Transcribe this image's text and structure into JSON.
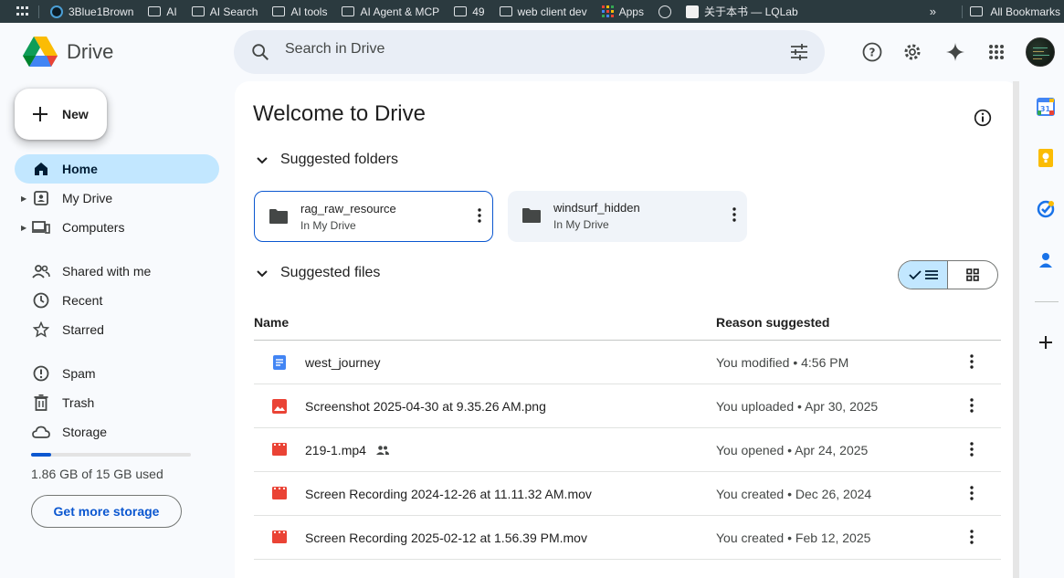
{
  "bookmarks": {
    "items": [
      "3Blue1Brown",
      "AI",
      "AI Search",
      "AI tools",
      "AI Agent & MCP",
      "49",
      "web client dev",
      "Apps",
      "",
      "关于本书 — LQLab"
    ],
    "more": "»",
    "all_bookmarks": "All Bookmarks"
  },
  "app": {
    "name": "Drive"
  },
  "search": {
    "placeholder": "Search in Drive"
  },
  "sidebar": {
    "new_label": "New",
    "items": [
      {
        "label": "Home",
        "icon": "home-icon",
        "active": true
      },
      {
        "label": "My Drive",
        "icon": "my-drive-icon"
      },
      {
        "label": "Computers",
        "icon": "computers-icon"
      },
      {
        "label": "Shared with me",
        "icon": "shared-icon"
      },
      {
        "label": "Recent",
        "icon": "clock-icon"
      },
      {
        "label": "Starred",
        "icon": "star-icon"
      },
      {
        "label": "Spam",
        "icon": "spam-icon"
      },
      {
        "label": "Trash",
        "icon": "trash-icon"
      },
      {
        "label": "Storage",
        "icon": "cloud-icon"
      }
    ],
    "storage_used_fraction": 0.124,
    "storage_text": "1.86 GB of 15 GB used",
    "get_storage": "Get more storage"
  },
  "main": {
    "title": "Welcome to Drive",
    "suggested_folders_label": "Suggested folders",
    "folders": [
      {
        "name": "rag_raw_resource",
        "location": "In My Drive"
      },
      {
        "name": "windsurf_hidden",
        "location": "In My Drive"
      }
    ],
    "suggested_files_label": "Suggested files",
    "columns": {
      "name": "Name",
      "reason": "Reason suggested"
    },
    "files": [
      {
        "name": "west_journey",
        "type": "doc",
        "reason": "You modified • 4:56 PM",
        "shared": false
      },
      {
        "name": "Screenshot 2025-04-30 at 9.35.26 AM.png",
        "type": "image",
        "reason": "You uploaded • Apr 30, 2025",
        "shared": false
      },
      {
        "name": "219-1.mp4",
        "type": "video",
        "reason": "You opened • Apr 24, 2025",
        "shared": true
      },
      {
        "name": "Screen Recording 2024-12-26 at 11.11.32 AM.mov",
        "type": "video",
        "reason": "You created • Dec 26, 2024",
        "shared": false
      },
      {
        "name": "Screen Recording 2025-02-12 at 1.56.39 PM.mov",
        "type": "video",
        "reason": "You created • Feb 12, 2025",
        "shared": false
      }
    ]
  },
  "colors": {
    "accent": "#0b57d0",
    "active_bg": "#c2e7ff",
    "doc_blue": "#4285f4",
    "file_red": "#ea4335"
  }
}
